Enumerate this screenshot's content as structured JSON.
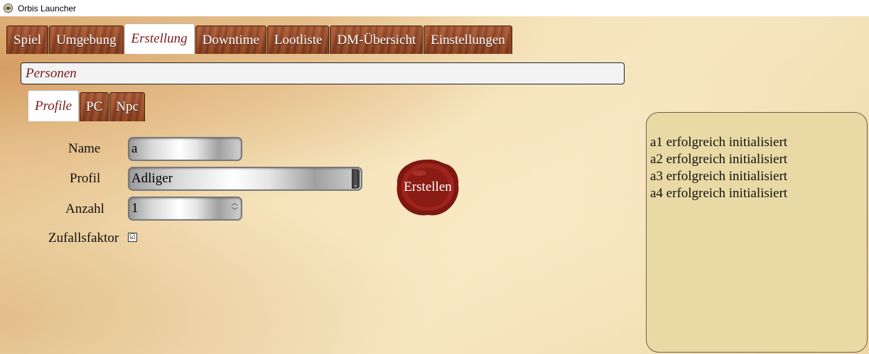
{
  "window": {
    "title": "Orbis Launcher",
    "icon": "orbis-app-icon"
  },
  "main_tabs": [
    {
      "label": "Spiel",
      "active": false
    },
    {
      "label": "Umgebung",
      "active": false
    },
    {
      "label": "Erstellung",
      "active": true
    },
    {
      "label": "Downtime",
      "active": false
    },
    {
      "label": "Lootliste",
      "active": false
    },
    {
      "label": "DM-Übersicht",
      "active": false
    },
    {
      "label": "Einstellungen",
      "active": false
    }
  ],
  "section": {
    "title": "Personen"
  },
  "sub_tabs": [
    {
      "label": "Profile",
      "active": true
    },
    {
      "label": "PC",
      "active": false
    },
    {
      "label": "Npc",
      "active": false
    }
  ],
  "form": {
    "name_label": "Name",
    "name_value": "a",
    "profil_label": "Profil",
    "profil_value": "Adliger",
    "anzahl_label": "Anzahl",
    "anzahl_value": "1",
    "zufall_label": "Zufallsfaktor",
    "zufall_checked": true,
    "checkmark": "☑"
  },
  "create_button": {
    "label": "Erstellen",
    "color": "#8b1a14"
  },
  "log": {
    "lines": [
      "a1 erfolgreich initialisiert",
      "a2 erfolgreich initialisiert",
      "a3 erfolgreich initialisiert",
      "a4 erfolgreich initialisiert"
    ]
  },
  "colors": {
    "tab_wood": "#9a4a25",
    "active_tab_text": "#7a1a1a",
    "log_panel_bg": "#e9d9a4",
    "parchment": "#f3e3bd"
  }
}
